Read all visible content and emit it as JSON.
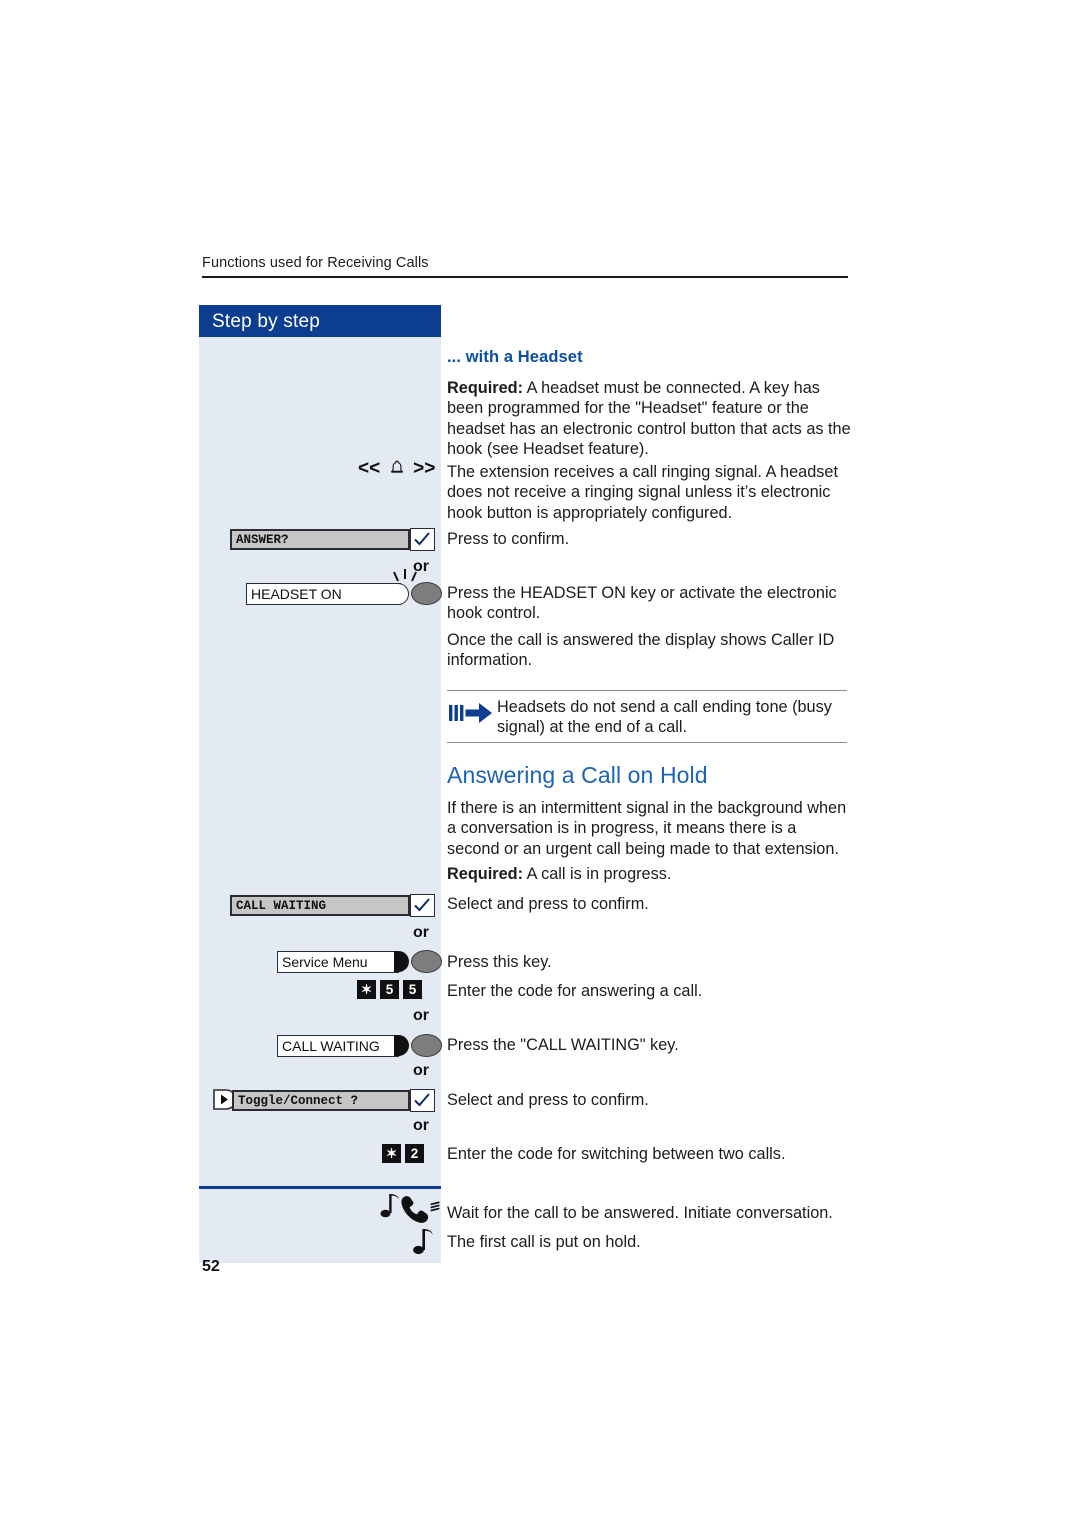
{
  "page": {
    "running_header": "Functions used for Receiving Calls",
    "page_number": "52",
    "sidebar_title": "Step by step"
  },
  "section_headset": {
    "heading": "... with a Headset",
    "required_label": "Required:",
    "required_text": " A headset must be connected. A key has been programmed for the \"Headset\" feature or the headset has an electronic control button that acts as the hook (see Headset feature).",
    "para_ring": "The extension receives a call ringing signal. A headset does not receive a ringing signal unless it’s electronic hook button is appropriately configured.",
    "confirm_text": "Press to confirm.",
    "headset_key_text": "Press the HEADSET ON key or activate the electronic hook control.",
    "caller_id_text": "Once the call is answered the display shows Caller ID information."
  },
  "note": {
    "icon": "note-arrow-icon",
    "text": "Headsets do not send a call ending tone (busy signal) at the end of a call."
  },
  "section_hold": {
    "heading": "Answering a Call on Hold",
    "intro": "If there is an intermittent signal in the background when a conversation is in progress, it means there is a second or an urgent call being made to that extension.",
    "required_label": "Required:",
    "required_text": " A call is in progress.",
    "select_confirm_1": "Select and press to confirm.",
    "press_this_key": "Press this key.",
    "enter_code_answer": "Enter the code for answering a call.",
    "press_cw_key": "Press the \"CALL WAITING\" key.",
    "select_confirm_2": "Select and press to confirm.",
    "enter_code_toggle": "Enter the code for switching between two calls.",
    "wait_answer": "Wait for the call to be answered. Initiate conversation.",
    "first_on_hold": "The first call is put on hold."
  },
  "widgets": {
    "ring_indicator": {
      "left": "<<",
      "icon": "bell-icon",
      "right": ">>"
    },
    "answer_softkey": {
      "label": "ANSWER?",
      "confirm_icon": "checkmark-icon"
    },
    "headset_on_key": {
      "label": "HEADSET ON",
      "lamp": "blinking-lamp-icon"
    },
    "call_waiting_softkey": {
      "label": "CALL WAITING",
      "confirm_icon": "checkmark-icon"
    },
    "service_menu_key": {
      "label": "Service Menu",
      "lamp": "lamp-icon"
    },
    "code_answer": [
      "✶",
      "5",
      "5"
    ],
    "call_waiting_key": {
      "label": "CALL WAITING",
      "lamp": "lamp-icon"
    },
    "toggle_softkey": {
      "arrow_icon": "nav-right-icon",
      "label": "Toggle/Connect ?",
      "confirm_icon": "checkmark-icon"
    },
    "code_toggle": [
      "✶",
      "2"
    ],
    "handset_ring_icon": "handset-ringing-icon",
    "music_note_icon": "music-note-icon",
    "or_label": "or"
  }
}
